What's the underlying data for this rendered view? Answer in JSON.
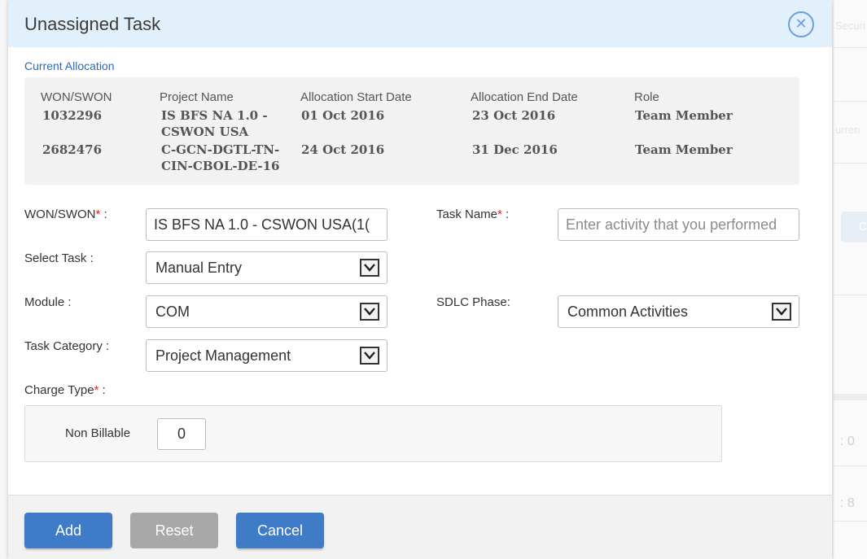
{
  "background": {
    "texts": [
      "Securi",
      "urren",
      ": 0",
      ": 8"
    ]
  },
  "modal": {
    "title": "Unassigned Task",
    "close_icon": "close-circle-icon",
    "section_label": "Current Allocation"
  },
  "allocation": {
    "headers": [
      "WON/SWON",
      "Project Name",
      "Allocation Start Date",
      "Allocation End Date",
      "Role"
    ],
    "rows": [
      {
        "won": "1032296",
        "project_line1": "IS BFS NA 1.0 -",
        "project_line2": "CSWON USA",
        "start": "01 Oct 2016",
        "end": "23 Oct 2016",
        "role": "Team Member"
      },
      {
        "won": "2682476",
        "project_line1": "C-GCN-DGTL-TN-",
        "project_line2": "CIN-CBOL-DE-16",
        "start": "24 Oct 2016",
        "end": "31 Dec 2016",
        "role": "Team Member"
      }
    ]
  },
  "form": {
    "won_label": "WON/SWON",
    "won_value": "IS BFS NA 1.0 - CSWON USA(1(",
    "task_name_label": "Task Name",
    "task_name_placeholder": "Enter activity that you performed",
    "select_task_label": "Select Task :",
    "select_task_value": "Manual Entry",
    "module_label": "Module :",
    "module_value": "COM",
    "sdlc_label": "SDLC Phase:",
    "sdlc_value": "Common Activities",
    "task_category_label": "Task Category :",
    "task_category_value": "Project Management",
    "charge_type_label": "Charge Type",
    "required_mark": "*",
    "colon": " :",
    "non_billable_label": "Non Billable",
    "non_billable_value": "0"
  },
  "footer": {
    "add_label": "Add",
    "reset_label": "Reset",
    "cancel_label": "Cancel"
  },
  "colors": {
    "header_bg": "#e2f0fb",
    "primary": "#3f7cc7",
    "disabled": "#a8a8a8",
    "required": "#e02020",
    "link": "#2c6bb5"
  }
}
